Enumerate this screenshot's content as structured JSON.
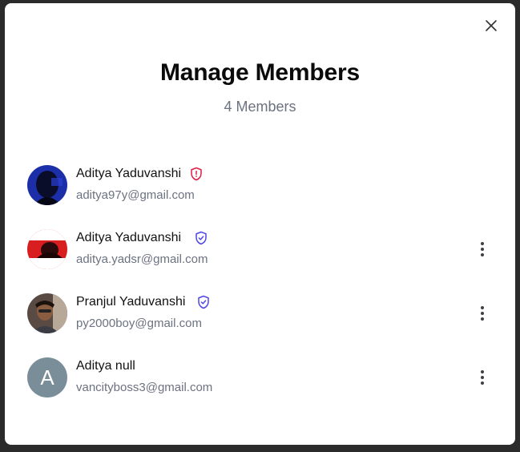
{
  "modal": {
    "title": "Manage Members",
    "subtitle": "4 Members"
  },
  "members": [
    {
      "name": "Aditya Yaduvanshi",
      "email": "aditya97y@gmail.com",
      "badge": "shield-alert-icon",
      "badge_color": "#e11d48",
      "avatar": "photo"
    },
    {
      "name": "Aditya Yaduvanshi",
      "email": "aditya.yadsr@gmail.com",
      "badge": "shield-check-icon",
      "badge_color": "#4f46e5",
      "avatar": "photo"
    },
    {
      "name": "Pranjul Yaduvanshi",
      "email": "py2000boy@gmail.com",
      "badge": "shield-check-icon",
      "badge_color": "#4f46e5",
      "avatar": "photo"
    },
    {
      "name": "Aditya null",
      "email": "vancityboss3@gmail.com",
      "avatar": "letter",
      "avatar_letter": "A"
    }
  ]
}
